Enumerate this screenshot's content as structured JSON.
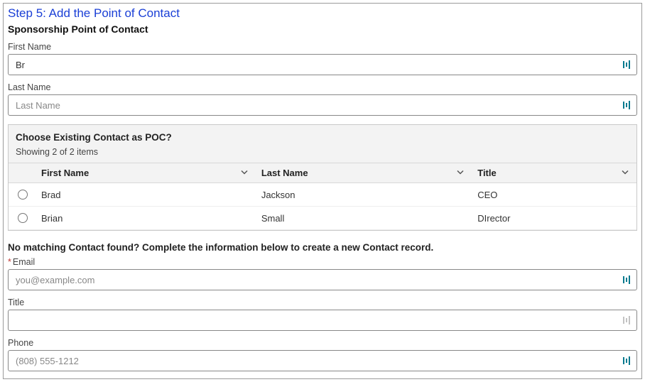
{
  "step_title": "Step 5: Add the Point of Contact",
  "section_title": "Sponsorship Point of Contact",
  "fields": {
    "first_name": {
      "label": "First Name",
      "value": "Br",
      "placeholder": ""
    },
    "last_name": {
      "label": "Last Name",
      "value": "",
      "placeholder": "Last Name"
    }
  },
  "existing": {
    "title": "Choose Existing Contact as POC?",
    "showing": "Showing 2 of 2 items",
    "columns": {
      "first": "First Name",
      "last": "Last Name",
      "title": "Title"
    },
    "rows": [
      {
        "first": "Brad",
        "last": "Jackson",
        "title": "CEO"
      },
      {
        "first": "Brian",
        "last": "Small",
        "title": "DIrector"
      }
    ]
  },
  "no_match_text": "No matching Contact found? Complete the information below to create a new Contact record.",
  "new_contact": {
    "email": {
      "label": "Email",
      "placeholder": "you@example.com",
      "value": ""
    },
    "title": {
      "label": "Title",
      "placeholder": "",
      "value": ""
    },
    "phone": {
      "label": "Phone",
      "placeholder": "(808) 555-1212",
      "value": ""
    }
  },
  "colors": {
    "accent": "#047a8f"
  }
}
